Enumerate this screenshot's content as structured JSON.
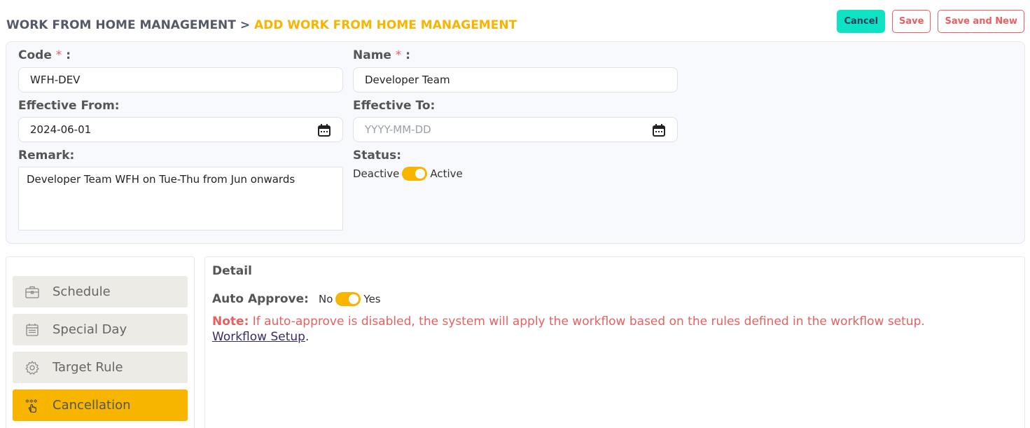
{
  "breadcrumb": {
    "parent": "WORK FROM HOME MANAGEMENT",
    "separator": ">",
    "current": "ADD WORK FROM HOME MANAGEMENT"
  },
  "actions": {
    "cancel": "Cancel",
    "save": "Save",
    "save_new": "Save and New"
  },
  "form": {
    "code": {
      "label": "Code",
      "required": "*",
      "colon": ":",
      "value": "WFH-DEV"
    },
    "name": {
      "label": "Name",
      "required": "*",
      "colon": ":",
      "value": "Developer Team"
    },
    "effective_from": {
      "label": "Effective From:",
      "value": "2024-06-01"
    },
    "effective_to": {
      "label": "Effective To:",
      "value": "",
      "placeholder": "YYYY-MM-DD"
    },
    "remark": {
      "label": "Remark:",
      "value": "Developer Team WFH on Tue-Thu from Jun onwards"
    },
    "status": {
      "label": "Status:",
      "off_label": "Deactive",
      "on_label": "Active",
      "on": true
    }
  },
  "sidebar": {
    "items": [
      {
        "label": "Schedule",
        "icon": "briefcase-icon",
        "active": false
      },
      {
        "label": "Special Day",
        "icon": "calendar-list-icon",
        "active": false
      },
      {
        "label": "Target Rule",
        "icon": "gear-icon",
        "active": false
      },
      {
        "label": "Cancellation",
        "icon": "hand-stars-icon",
        "active": true
      }
    ]
  },
  "detail": {
    "title": "Detail",
    "auto_approve": {
      "label": "Auto Approve:",
      "off_label": "No",
      "on_label": "Yes",
      "on": true
    },
    "note_prefix": "Note:",
    "note_text": "If auto-approve is disabled, the system will apply the workflow based on the rules defined in the workflow setup.",
    "link": "Workflow Setup",
    "link_suffix": "."
  },
  "colors": {
    "accent": "#f7b500",
    "cancel_bg": "#0ee2c4",
    "danger": "#e86060"
  }
}
